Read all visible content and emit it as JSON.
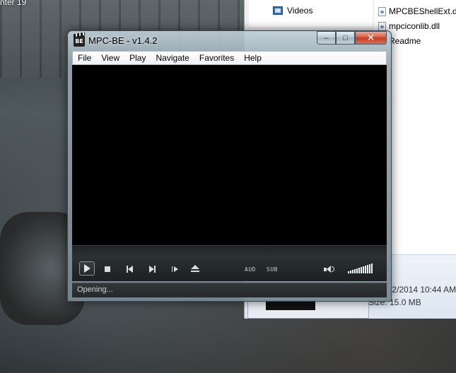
{
  "desktop": {
    "label": "nter 19"
  },
  "explorer": {
    "nav_items": [
      {
        "label": "Videos",
        "icon": "video-folder-icon"
      }
    ],
    "files": [
      {
        "name": "MPCBEShellExt.dll",
        "icon": "dll-file-icon"
      },
      {
        "name": "mpciconlib.dll",
        "icon": "dll-file-icon"
      },
      {
        "name": "Readme",
        "icon": "text-file-icon"
      }
    ],
    "details": {
      "date": "/2/2014 10:44 AM",
      "size": "Size: 15.0 MB"
    }
  },
  "mpc": {
    "title": "MPC-BE - v1.4.2",
    "app_icon_text": "BE",
    "window_buttons": {
      "minimize": "‒",
      "maximize": "□",
      "close": "✕"
    },
    "menu": [
      "File",
      "View",
      "Play",
      "Navigate",
      "Favorites",
      "Help"
    ],
    "controls": {
      "audio_label": "AUD",
      "subtitle_label": "SUB",
      "volume_level": 1.0
    },
    "status": "Opening..."
  },
  "colors": {
    "video_bg": "#000000",
    "close_red": "#c03a1f",
    "chrome": "#1c2022"
  }
}
